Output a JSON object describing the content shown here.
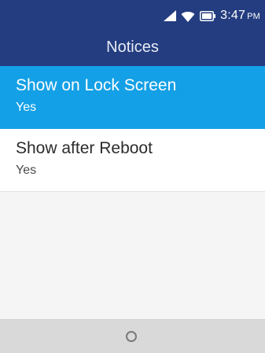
{
  "status_bar": {
    "signal_icon": "signal-icon",
    "wifi_icon": "wifi-icon",
    "battery_icon": "battery-icon",
    "time": "3:47",
    "ampm": "PM"
  },
  "header": {
    "title": "Notices"
  },
  "list": {
    "items": [
      {
        "label": "Show on Lock Screen",
        "value": "Yes",
        "selected": true
      },
      {
        "label": "Show after Reboot",
        "value": "Yes",
        "selected": false
      }
    ]
  },
  "softkeys": {
    "center_icon": "circle-select-icon"
  },
  "colors": {
    "header": "#243d80",
    "selected": "#14a0e6",
    "background": "#f5f5f5",
    "softkey_bar": "#d9d9d9"
  }
}
